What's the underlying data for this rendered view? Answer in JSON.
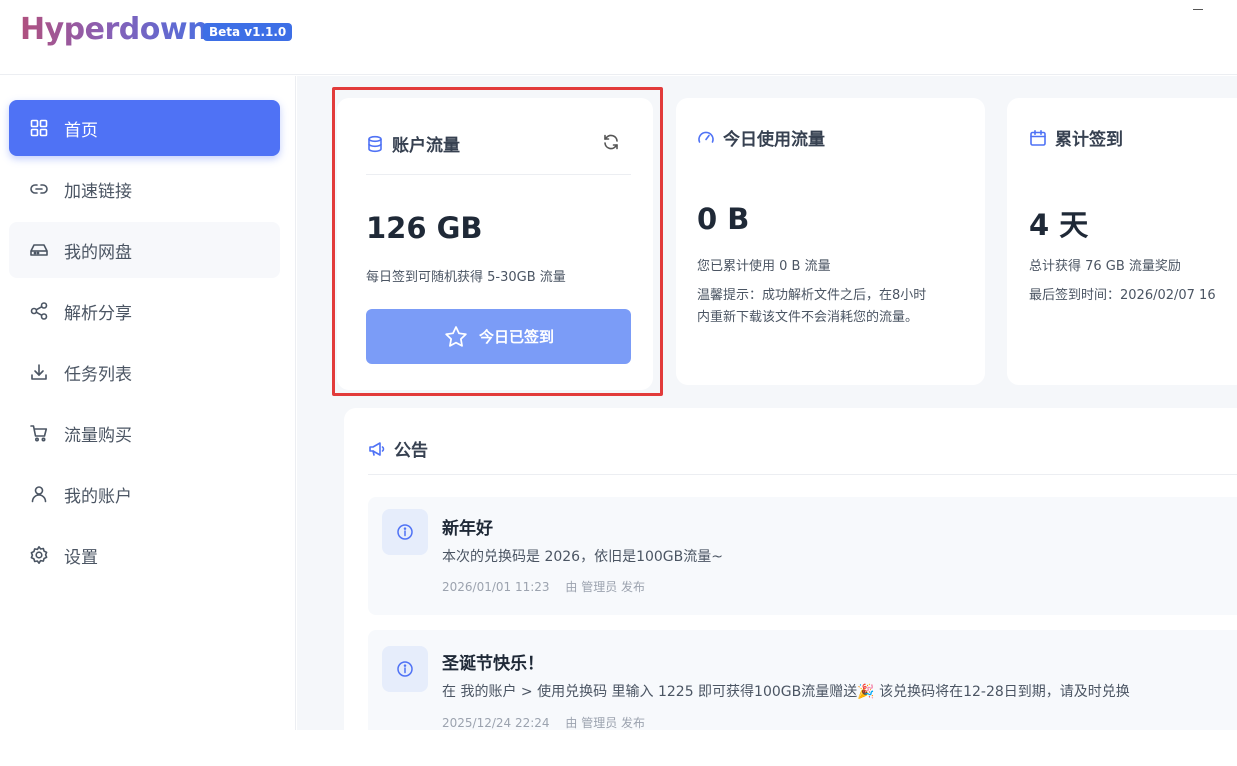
{
  "app": {
    "logo": "Hyperdown",
    "badge": "Beta v1.1.0"
  },
  "sidebar": {
    "items": [
      {
        "label": "首页",
        "icon": "grid-icon"
      },
      {
        "label": "加速链接",
        "icon": "link-icon"
      },
      {
        "label": "我的网盘",
        "icon": "hard-drive-icon"
      },
      {
        "label": "解析分享",
        "icon": "share-icon"
      },
      {
        "label": "任务列表",
        "icon": "download-icon"
      },
      {
        "label": "流量购买",
        "icon": "cart-icon"
      },
      {
        "label": "我的账户",
        "icon": "user-icon"
      },
      {
        "label": "设置",
        "icon": "gear-icon"
      }
    ]
  },
  "cards": {
    "account_traffic": {
      "title": "账户流量",
      "value": "126 GB",
      "desc": "每日签到可随机获得 5-30GB 流量",
      "button": "今日已签到"
    },
    "today_usage": {
      "title": "今日使用流量",
      "value": "0 B",
      "desc": "您已累计使用 0 B 流量",
      "tip_line1": "温馨提示：成功解析文件之后，在8小时",
      "tip_line2": "内重新下载该文件不会消耗您的流量。"
    },
    "checkin": {
      "title": "累计签到",
      "value": "4 天",
      "desc": "总计获得 76 GB 流量奖励",
      "last": "最后签到时间：2026/02/07 16"
    }
  },
  "notice": {
    "title": "公告",
    "items": [
      {
        "title": "新年好",
        "body": "本次的兑换码是 2026，依旧是100GB流量~",
        "date": "2026/01/01 11:23",
        "by": "由 管理员 发布"
      },
      {
        "title": "圣诞节快乐！",
        "body": "在 我的账户 > 使用兑换码 里输入 1225 即可获得100GB流量赠送🎉 该兑换码将在12-28日到期，请及时兑换",
        "date": "2025/12/24 22:24",
        "by": "由 管理员 发布"
      }
    ]
  },
  "colors": {
    "accent": "#4f72f5",
    "button": "#7b9cf7",
    "highlight": "#e23b3b"
  }
}
